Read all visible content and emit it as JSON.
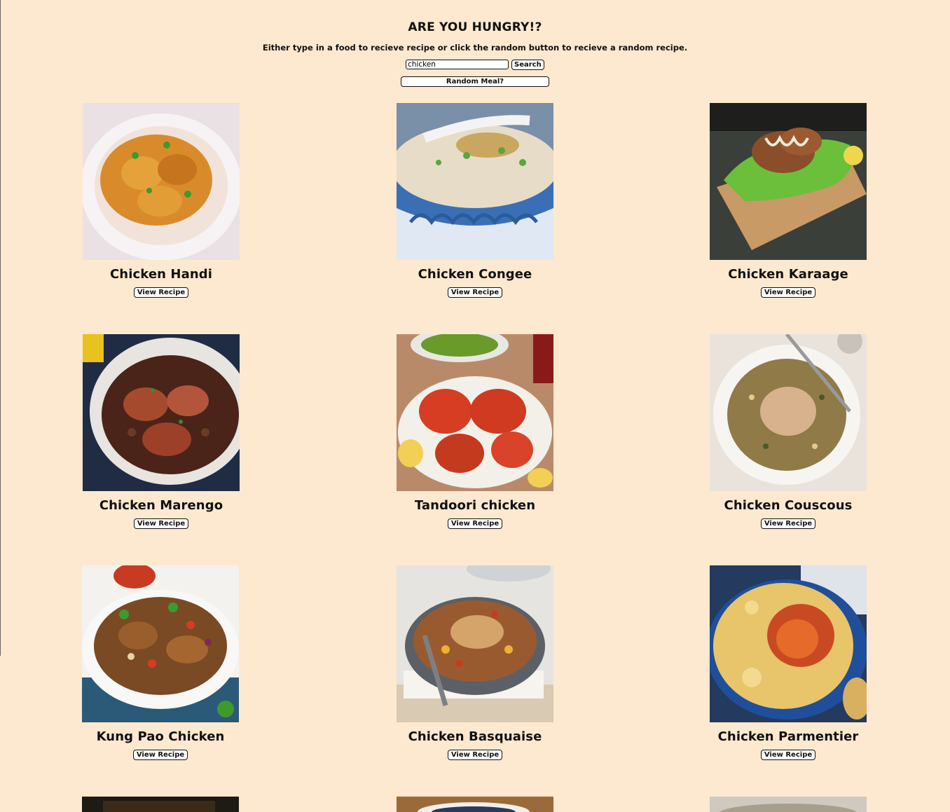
{
  "header": {
    "title": "ARE YOU HUNGRY!?",
    "subtitle": "Either type in a food to recieve recipe or click the random button to recieve a random recipe."
  },
  "search": {
    "value": "chicken",
    "button_label": "Search",
    "random_label": "Random Meal?"
  },
  "view_label": "View Recipe",
  "meals": [
    {
      "name": "Chicken Handi"
    },
    {
      "name": "Chicken Congee"
    },
    {
      "name": "Chicken Karaage"
    },
    {
      "name": "Chicken Marengo"
    },
    {
      "name": "Tandoori chicken"
    },
    {
      "name": "Chicken Couscous"
    },
    {
      "name": "Kung Pao Chicken"
    },
    {
      "name": "Chicken Basquaise"
    },
    {
      "name": "Chicken Parmentier"
    }
  ]
}
